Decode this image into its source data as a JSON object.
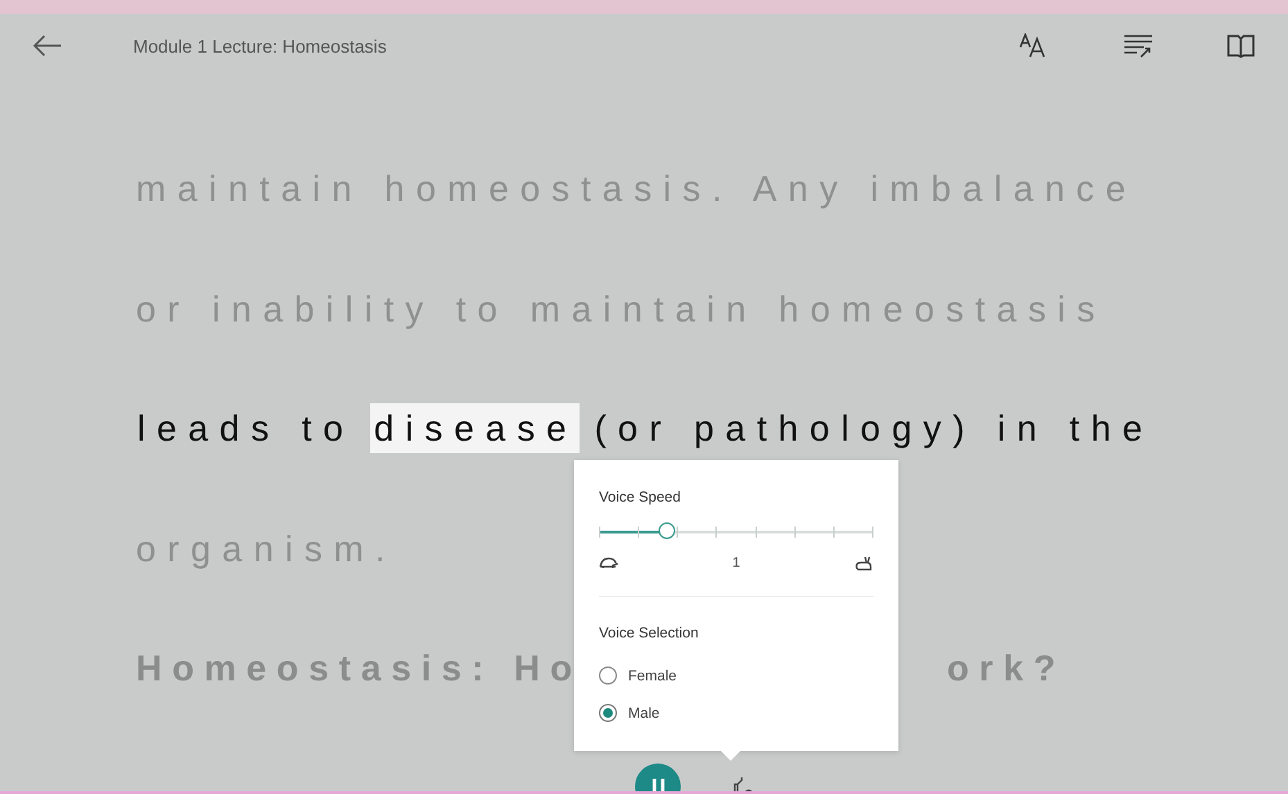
{
  "header": {
    "title": "Module 1 Lecture: Homeostasis"
  },
  "lines": [
    {
      "kind": "read",
      "text": "maintain homeostasis. Any imbalance"
    },
    {
      "kind": "read",
      "text": "or inability to maintain homeostasis"
    },
    {
      "kind": "current",
      "segments": [
        {
          "text": "leads to",
          "highlighted": false
        },
        {
          "text": "disease",
          "highlighted": true
        },
        {
          "text": "(or pathology) in the",
          "highlighted": false
        }
      ]
    },
    {
      "kind": "read",
      "text": "organism."
    },
    {
      "kind": "heading",
      "parts": [
        "Homeostasis: Ho",
        "ork?"
      ]
    }
  ],
  "voice_popup": {
    "speed_title": "Voice Speed",
    "speed": {
      "level": 0.25
    },
    "speed_value": "1",
    "selection_title": "Voice Selection",
    "voices": [
      {
        "label": "Female",
        "selected": false
      },
      {
        "label": "Male",
        "selected": true
      }
    ]
  },
  "player": {
    "playing": true
  }
}
